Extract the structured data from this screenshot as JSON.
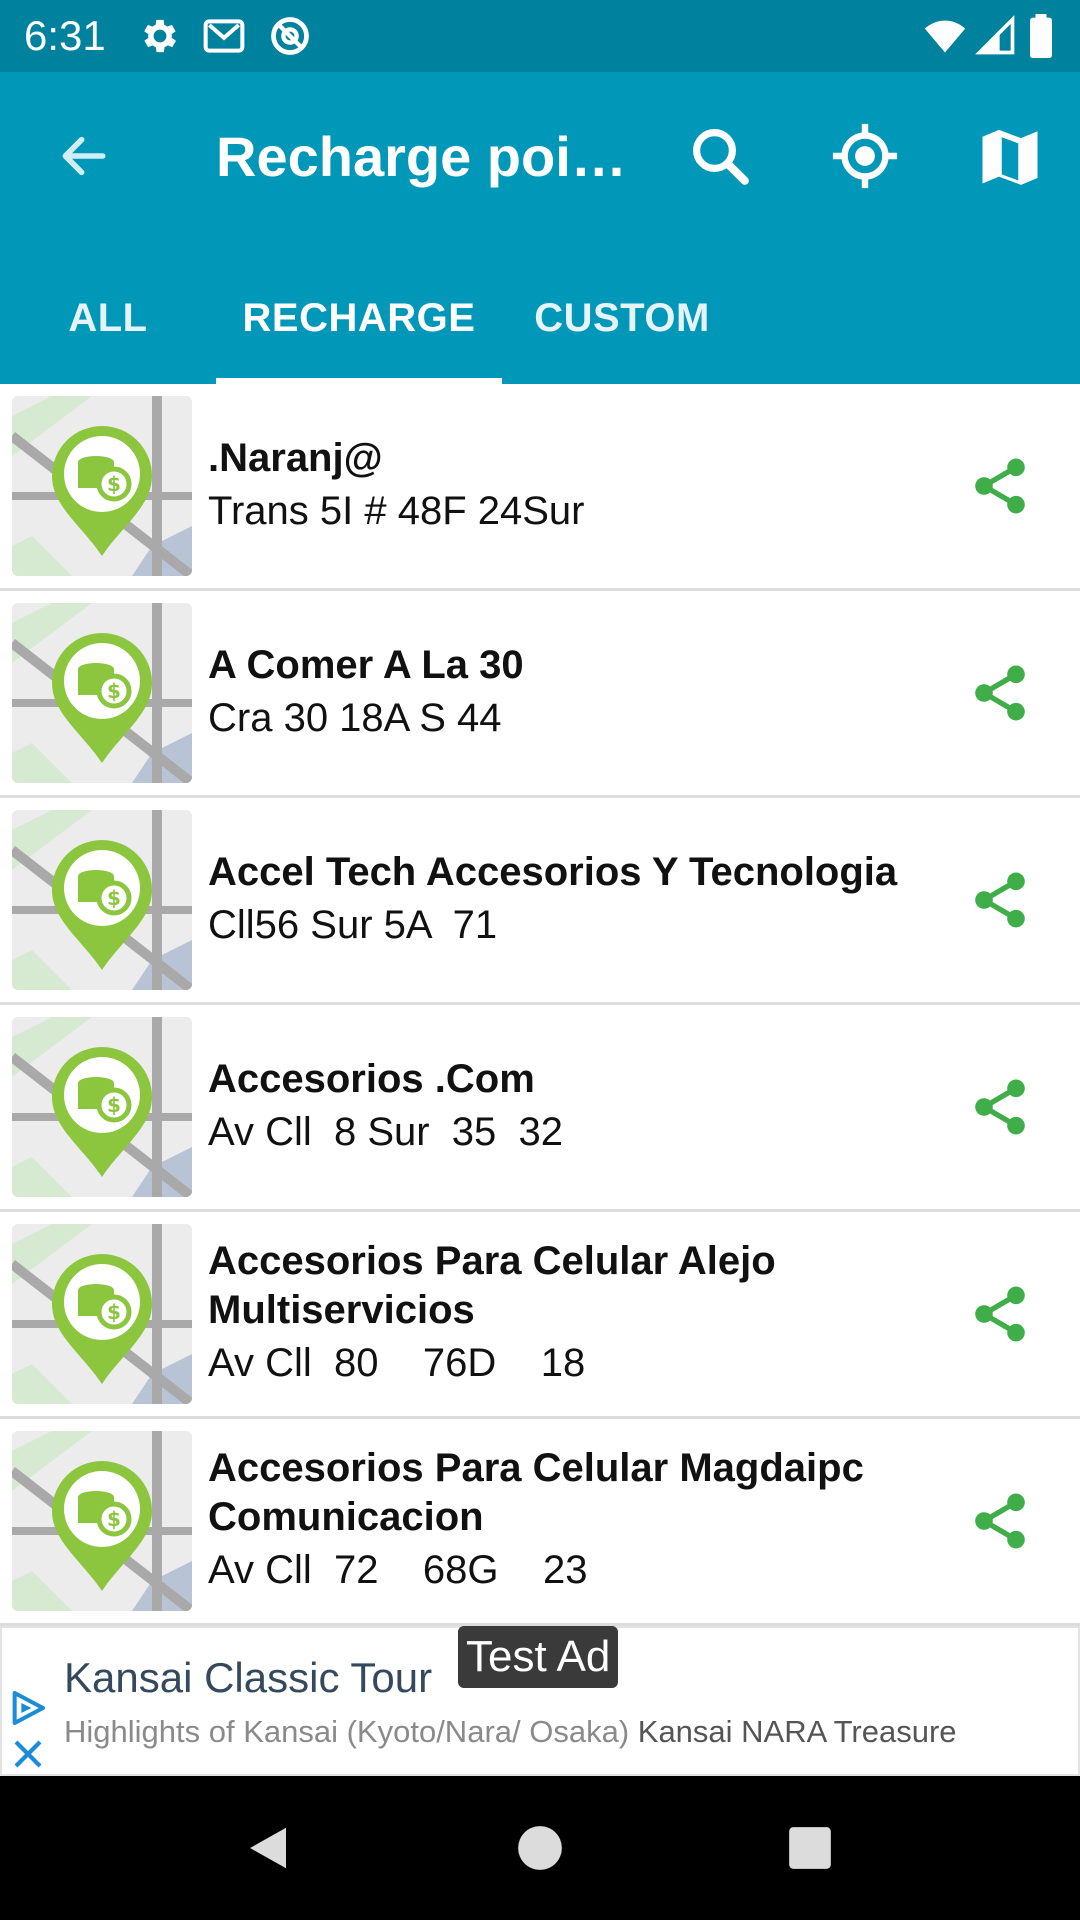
{
  "status_bar": {
    "time": "6:31",
    "icons": [
      "settings-icon",
      "gmail-icon",
      "at-sign-icon",
      "wifi-icon",
      "signal-icon",
      "battery-icon"
    ]
  },
  "app_bar": {
    "title": "Recharge poi…",
    "icons": [
      "back-arrow-icon",
      "search-icon",
      "my-location-icon",
      "map-icon"
    ],
    "tabs": [
      {
        "label": "ALL",
        "active": false
      },
      {
        "label": "RECHARGE",
        "active": true
      },
      {
        "label": "CUSTOM",
        "active": false
      }
    ]
  },
  "list": {
    "items": [
      {
        "title": ".Naranj@",
        "address": "Trans 5I # 48F 24Sur"
      },
      {
        "title": "A  Comer A La 30",
        "address": "Cra 30 18A S 44"
      },
      {
        "title": "Accel Tech Accesorios Y Tecnologia",
        "address": "Cll56 Sur 5A  71"
      },
      {
        "title": "Accesorios .Com",
        "address": "Av Cll  8 Sur  35  32"
      },
      {
        "title": "Accesorios Para Celular Alejo Multiservicios",
        "address": "Av Cll  80    76D    18"
      },
      {
        "title": "Accesorios Para Celular Magdaipc Comunicacion",
        "address": "Av Cll  72    68G    23"
      }
    ],
    "share_icon": "share-icon",
    "thumb_icon": "map-pin-coins-icon"
  },
  "ad": {
    "badge": "Test Ad",
    "title": "Kansai Classic Tour",
    "description_a": "Highlights of Kansai (Kyoto/Nara/ Osaka)",
    "description_b": " Kansai NARA Treasure"
  },
  "colors": {
    "status_bar": "#00819d",
    "app_bar": "#0097b8",
    "share_green": "#3fae49",
    "pin_green": "#8cc63f"
  }
}
